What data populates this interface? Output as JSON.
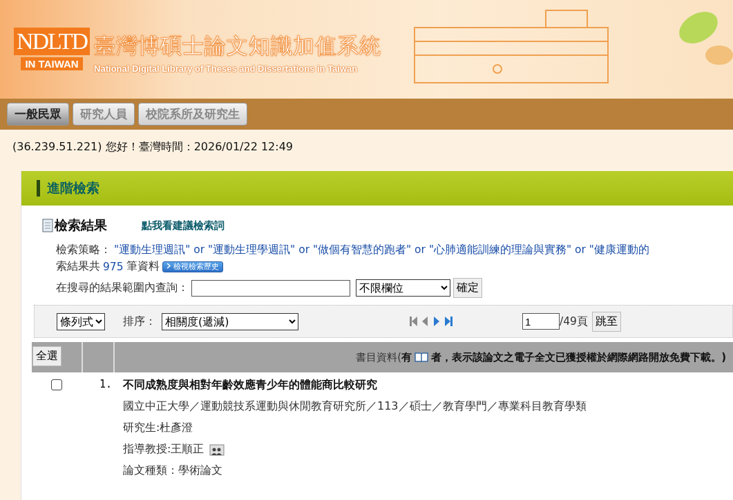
{
  "header": {
    "logo_top": "NDLTD",
    "logo_bottom": "IN TAIWAN",
    "title": "臺灣博碩士論文知識加值系統",
    "subtitle": "National Digital Library of Theses and Dissertations in Taiwan"
  },
  "tabs": [
    {
      "label": "一般民眾",
      "selected": true
    },
    {
      "label": "研究人員",
      "selected": false
    },
    {
      "label": "校院系所及研究生",
      "selected": false
    }
  ],
  "greeting": "(36.239.51.221) 您好！臺灣時間：2026/01/22 12:49",
  "panel": {
    "title": "進階檢索",
    "results_heading": "檢索結果",
    "suggest_link": "點我看建議檢索詞",
    "strategy_label": "檢索策略：",
    "strategy": "\"運動生理週訊\" or \"運動生理學週訊\" or \"做個有智慧的跑者\" or \"心肺適能訓練的理論與實務\" or \"健康運動的",
    "count_prefix": "索結果共",
    "count": "975",
    "count_suffix": "筆資料",
    "history_button": "檢視檢索歷史",
    "within_label": "在搜尋的結果範圍內查詢：",
    "field_select": "不限欄位",
    "confirm_button": "確定"
  },
  "toolbar": {
    "view_select": "條列式",
    "sort_label": "排序：",
    "sort_select": "相關度(遞減)",
    "pager_buttons": [
      {
        "kind": "first",
        "disabled": true
      },
      {
        "kind": "prev",
        "disabled": true
      },
      {
        "kind": "next",
        "disabled": false
      },
      {
        "kind": "last",
        "disabled": false
      }
    ],
    "page_value": "1",
    "page_total": "/49頁",
    "jump_button": "跳至"
  },
  "table": {
    "select_all": "全選",
    "header_before": "書目資料(**有**",
    "header_after": "者，表示該論文之電子全文已獲授權於網際網路開放免費下載。)",
    "rows": [
      {
        "checked": false,
        "number": "1.",
        "title": "不同成熟度與相對年齡效應青少年的體能商比較研究",
        "lines": [
          {
            "kind": "text",
            "text": "國立中正大學／運動競技系運動與休閒教育研究所／113／碩士／教育學門／專業科目教育學類"
          },
          {
            "kind": "text",
            "text": "研究生:杜彥澄"
          },
          {
            "kind": "advisor",
            "text": "指導教授:王順正"
          },
          {
            "kind": "text",
            "text": "論文種類：學術論文"
          }
        ]
      }
    ]
  }
}
